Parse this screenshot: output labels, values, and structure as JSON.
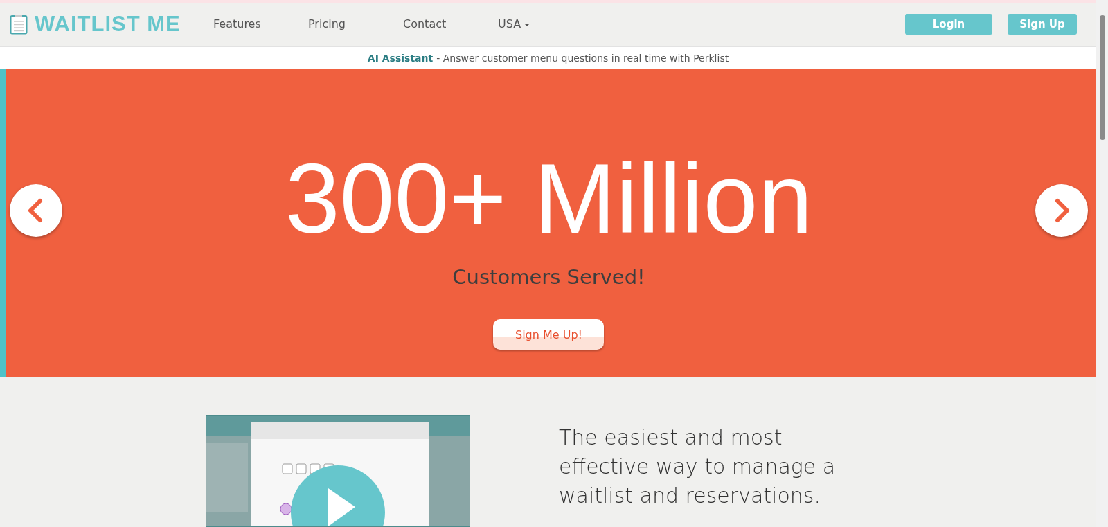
{
  "header": {
    "logo": "WAITLIST ME",
    "nav": [
      {
        "label": "Features",
        "kind": "link"
      },
      {
        "label": "Pricing",
        "kind": "link"
      },
      {
        "label": "Contact",
        "kind": "link"
      },
      {
        "label": "USA",
        "kind": "dropdown"
      }
    ],
    "buttons": [
      "Login",
      "Sign Up"
    ]
  },
  "announcement": {
    "highlight": "AI Assistant",
    "text": "- Answer customer menu questions in real time with Perklist"
  },
  "hero": {
    "headline": "300+ Million",
    "subtitle": "Customers Served!",
    "cta": "Sign Me Up!"
  },
  "feature": {
    "text": "The easiest and most effective way to manage a waitlist and reservations."
  }
}
